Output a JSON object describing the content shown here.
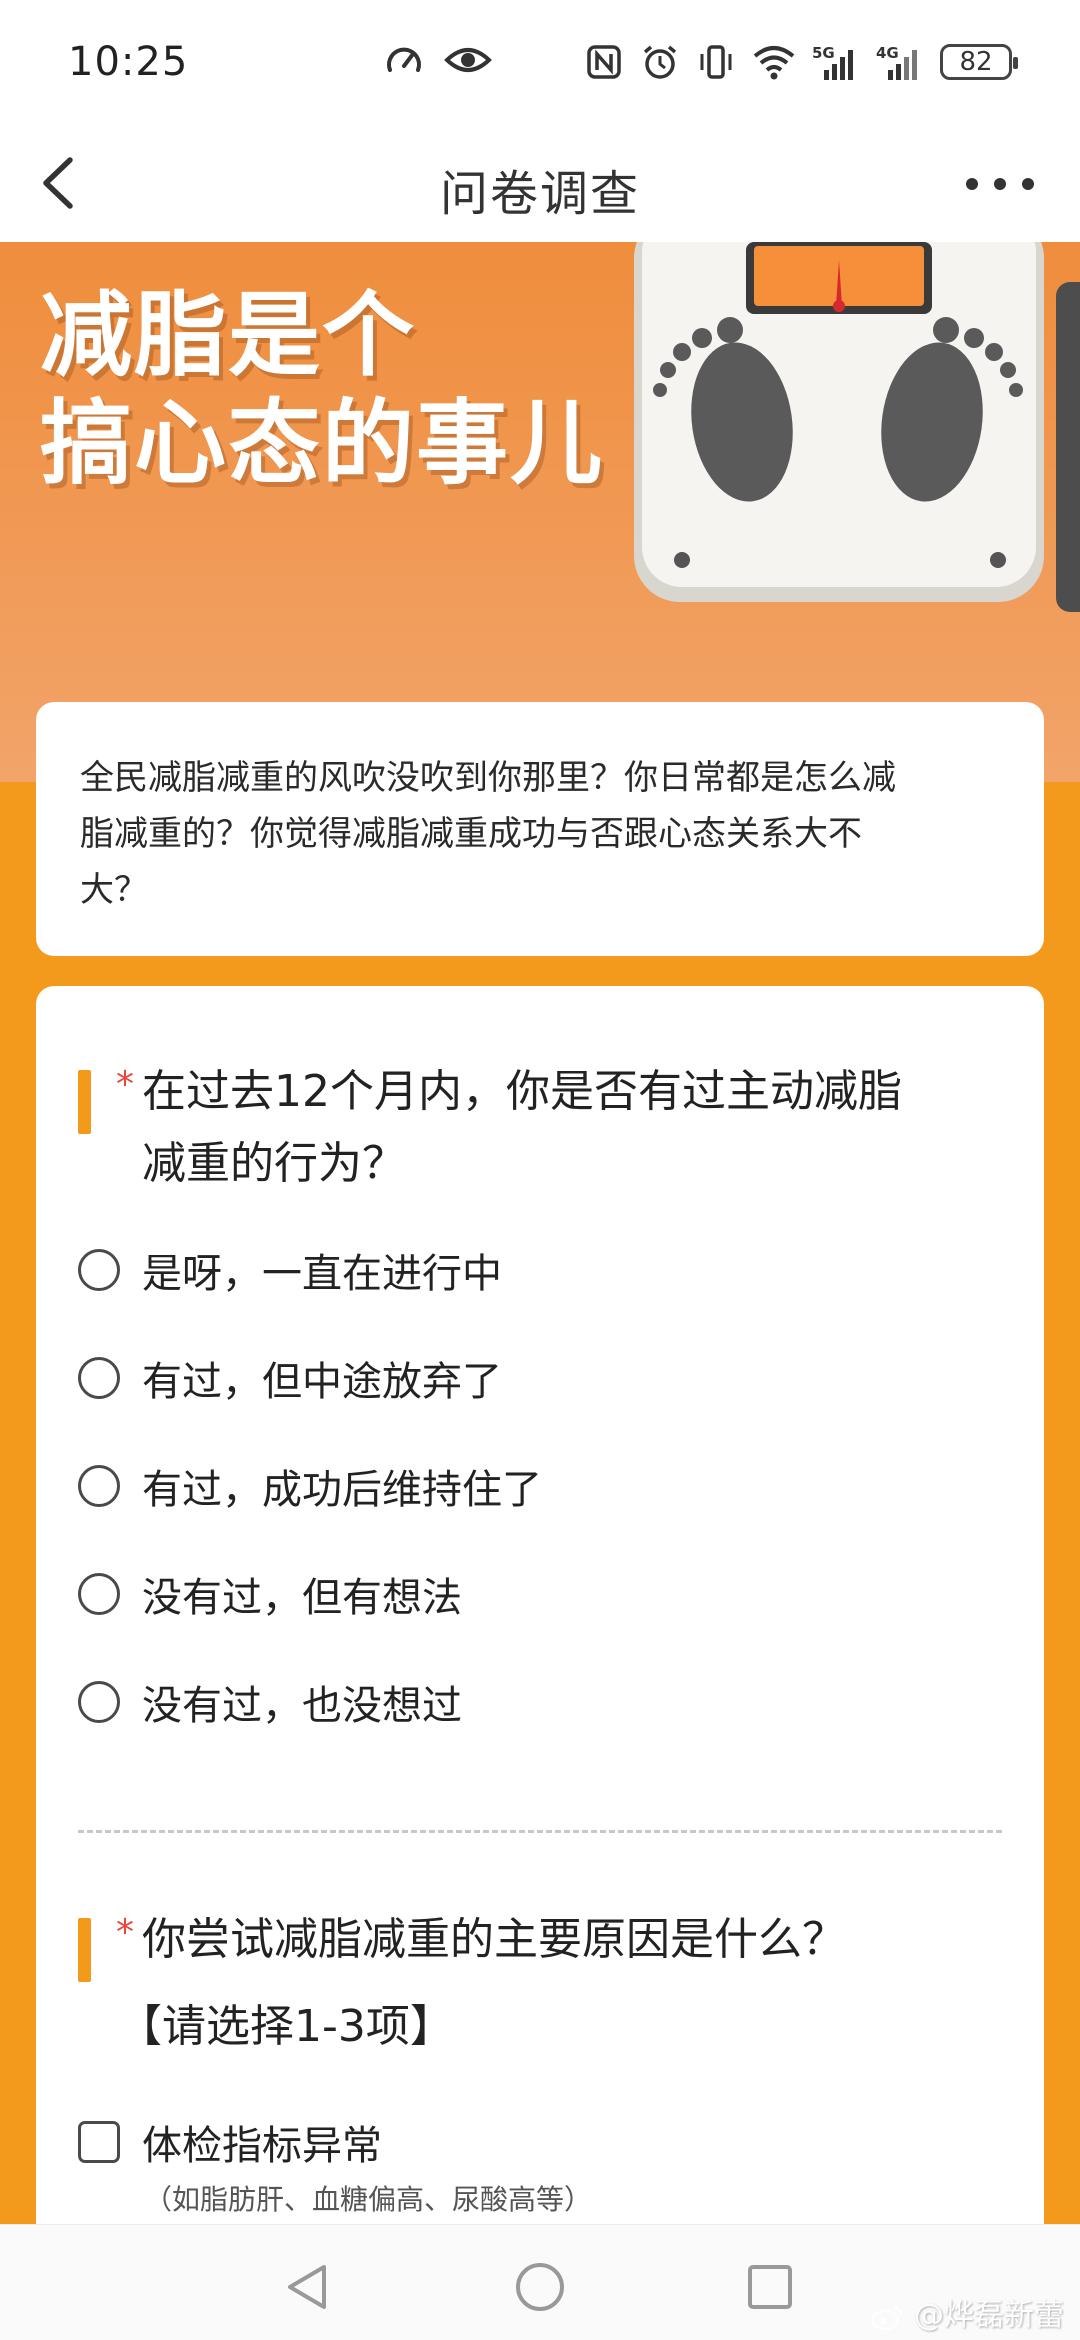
{
  "status_bar": {
    "time": "10:25",
    "battery": "82",
    "network_labels": [
      "5G",
      "4G"
    ]
  },
  "nav": {
    "title": "问卷调查"
  },
  "banner": {
    "headline_line1": "减脂是个",
    "headline_line2": "搞心态的事儿"
  },
  "intro": {
    "text_line1": "全民减脂减重的风吹没吹到你那里？你日常都是怎么减",
    "text_line2": "脂减重的？你觉得减脂减重成功与否跟心态关系大不",
    "text_line3": "大？"
  },
  "question1": {
    "required_mark": "*",
    "text_line1": "在过去12个月内，你是否有过主动减脂",
    "text_line2": "减重的行为？",
    "options": [
      {
        "label": "是呀，一直在进行中"
      },
      {
        "label": "有过，但中途放弃了"
      },
      {
        "label": "有过，成功后维持住了"
      },
      {
        "label": "没有过，但有想法"
      },
      {
        "label": "没有过，也没想过"
      }
    ]
  },
  "question2": {
    "required_mark": "*",
    "text_line1": "你尝试减脂减重的主要原因是什么？",
    "note": "【请选择1-3项】",
    "options": [
      {
        "label": "体检指标异常",
        "sub": "（如脂肪肝、血糖偏高、尿酸高等）"
      }
    ]
  },
  "watermark": "@烨磊新蕾",
  "colors": {
    "accent": "#f39a1c",
    "banner": "#ef8d3c",
    "required": "#e8453c"
  },
  "icons": [
    "speedometer-icon",
    "eye-icon",
    "nfc-icon",
    "alarm-icon",
    "vibrate-icon",
    "wifi-icon",
    "signal-icon",
    "battery-icon",
    "back-arrow-icon",
    "more-dots-icon",
    "nav-back-icon",
    "nav-home-icon",
    "nav-recents-icon",
    "weibo-icon"
  ]
}
